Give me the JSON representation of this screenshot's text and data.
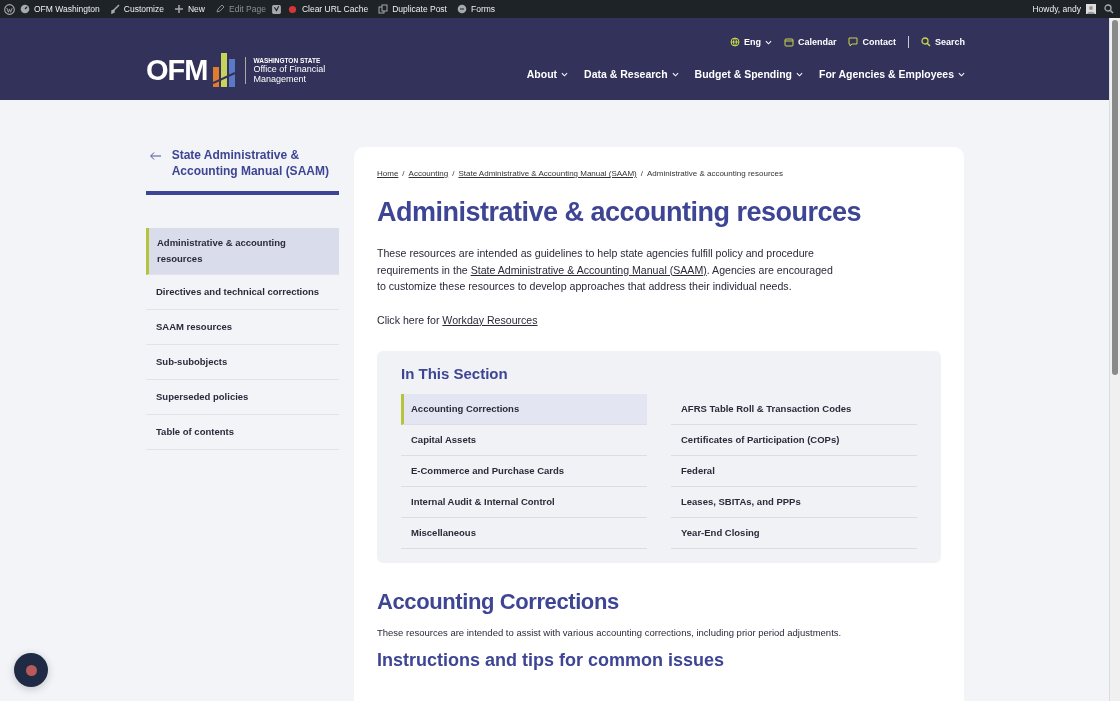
{
  "admin_bar": {
    "items": [
      {
        "label": "OFM Washington",
        "disabled": false
      },
      {
        "label": "Customize",
        "disabled": false
      },
      {
        "label": "New",
        "disabled": false
      },
      {
        "label": "Edit Page",
        "disabled": true
      },
      {
        "label": "Clear URL Cache",
        "disabled": false
      },
      {
        "label": "Duplicate Post",
        "disabled": false
      },
      {
        "label": "Forms",
        "disabled": false
      }
    ],
    "greeting": "Howdy, andy"
  },
  "header": {
    "logo": {
      "mark": "OFM",
      "kicker": "WASHINGTON STATE",
      "name": "Office of Financial Management"
    },
    "utility_links": [
      {
        "label": "Eng",
        "dropdown": true
      },
      {
        "label": "Calendar",
        "dropdown": false
      },
      {
        "label": "Contact",
        "dropdown": false
      },
      {
        "label": "Search",
        "dropdown": false
      }
    ],
    "nav": [
      "About",
      "Data & Research",
      "Budget & Spending",
      "For Agencies & Employees"
    ]
  },
  "sidebar": {
    "title": "State Administrative & Accounting Manual (SAAM)",
    "items": [
      {
        "label": "Administrative & accounting resources",
        "selected": true
      },
      {
        "label": "Directives and technical corrections",
        "selected": false
      },
      {
        "label": "SAAM resources",
        "selected": false
      },
      {
        "label": "Sub-subobjects",
        "selected": false
      },
      {
        "label": "Superseded policies",
        "selected": false
      },
      {
        "label": "Table of contents",
        "selected": false
      }
    ]
  },
  "breadcrumb_separator": "/",
  "breadcrumbs": [
    {
      "label": "Home",
      "link": true
    },
    {
      "label": "Accounting",
      "link": true
    },
    {
      "label": "State Administrative & Accounting Manual (SAAM)",
      "link": true
    },
    {
      "label": "Administrative & accounting resources",
      "link": false
    }
  ],
  "title": "Administrative & accounting resources",
  "intro": [
    {
      "text": "These resources are intended as guidelines to help state agencies fulfill policy and procedure requirements in the ",
      "link": false
    },
    {
      "text": "State Administrative & Accounting Manual (SAAM)",
      "link": true
    },
    {
      "text": ". Agencies are encouraged to customize these resources to develop approaches that address their individual needs.",
      "link": false
    }
  ],
  "workday": [
    {
      "text": "Click here for ",
      "link": false
    },
    {
      "text": "Workday Resources",
      "link": true
    }
  ],
  "in_this_section": {
    "title": "In This Section",
    "items": [
      {
        "label": "Accounting Corrections",
        "selected": true
      },
      {
        "label": "AFRS Table Roll & Transaction Codes",
        "selected": false
      },
      {
        "label": "Capital Assets",
        "selected": false
      },
      {
        "label": "Certificates of Participation (COPs)",
        "selected": false
      },
      {
        "label": "E-Commerce and Purchase Cards",
        "selected": false
      },
      {
        "label": "Federal",
        "selected": false
      },
      {
        "label": "Internal Audit & Internal Control",
        "selected": false
      },
      {
        "label": "Leases, SBITAs, and PPPs",
        "selected": false
      },
      {
        "label": "Miscellaneous",
        "selected": false
      },
      {
        "label": "Year-End Closing",
        "selected": false
      }
    ]
  },
  "section": {
    "heading": "Accounting Corrections",
    "text": "These resources are intended to assist with various accounting corrections, including prior period adjustments.",
    "subheading": "Instructions and tips for common issues"
  }
}
